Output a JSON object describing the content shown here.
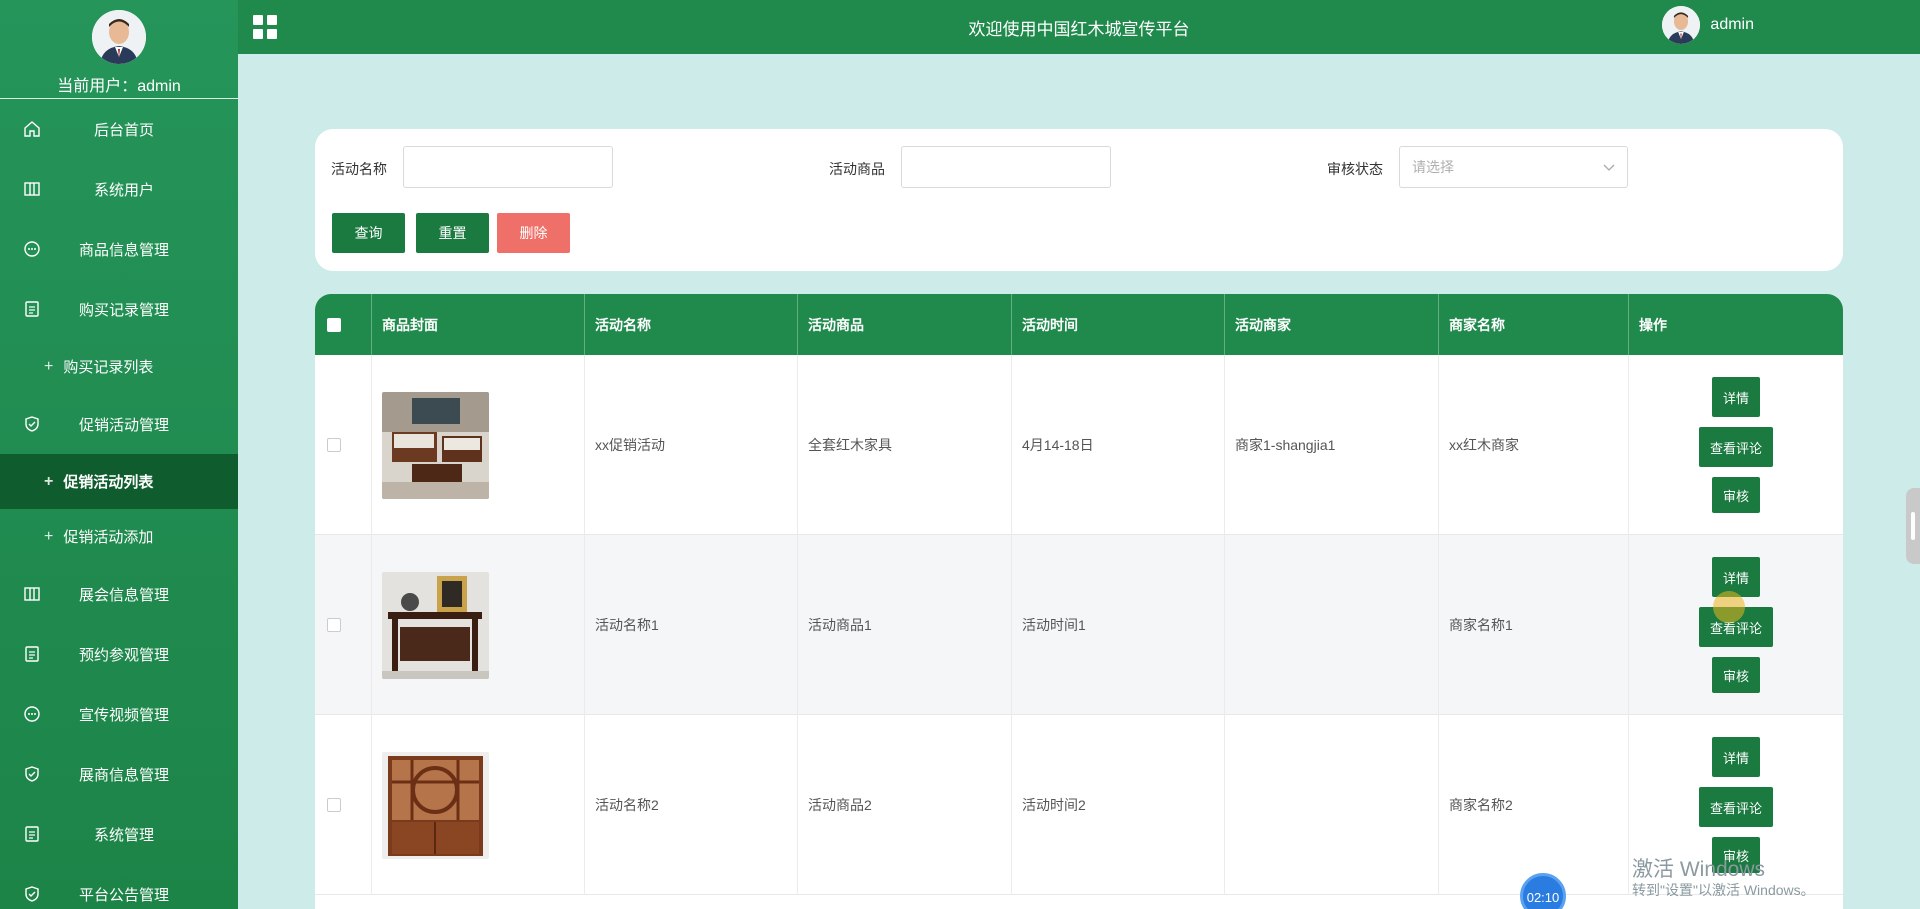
{
  "sidebar": {
    "user_label": "当前用户：admin",
    "items": [
      {
        "label": "后台首页",
        "icon": "home-icon"
      },
      {
        "label": "系统用户",
        "icon": "columns-icon"
      },
      {
        "label": "商品信息管理",
        "icon": "chat-icon"
      },
      {
        "label": "购买记录管理",
        "icon": "document-icon"
      },
      {
        "label": "购买记录列表",
        "sub": true
      },
      {
        "label": "促销活动管理",
        "icon": "shield-icon"
      },
      {
        "label": "促销活动列表",
        "sub": true,
        "active": true
      },
      {
        "label": "促销活动添加",
        "sub": true
      },
      {
        "label": "展会信息管理",
        "icon": "columns-icon"
      },
      {
        "label": "预约参观管理",
        "icon": "document-icon"
      },
      {
        "label": "宣传视频管理",
        "icon": "chat-icon"
      },
      {
        "label": "展商信息管理",
        "icon": "shield-icon"
      },
      {
        "label": "系统管理",
        "icon": "document-icon"
      },
      {
        "label": "平台公告管理",
        "icon": "shield-icon"
      }
    ]
  },
  "header": {
    "title": "欢迎使用中国红木城宣传平台",
    "username": "admin"
  },
  "search": {
    "activity_name_label": "活动名称",
    "activity_name_value": "",
    "activity_goods_label": "活动商品",
    "activity_goods_value": "",
    "status_label": "审核状态",
    "status_placeholder": "请选择",
    "query_label": "查询",
    "reset_label": "重置",
    "delete_label": "删除"
  },
  "table": {
    "headers": [
      "商品封面",
      "活动名称",
      "活动商品",
      "活动时间",
      "活动商家",
      "商家名称",
      "操作"
    ],
    "rows": [
      {
        "name": "xx促销活动",
        "goods": "全套红木家具",
        "time": "4月14-18日",
        "merchant": "商家1-shangjia1",
        "merchant_name": "xx红木商家"
      },
      {
        "name": "活动名称1",
        "goods": "活动商品1",
        "time": "活动时间1",
        "merchant": "",
        "merchant_name": "商家名称1"
      },
      {
        "name": "活动名称2",
        "goods": "活动商品2",
        "time": "活动时间2",
        "merchant": "",
        "merchant_name": "商家名称2"
      }
    ],
    "actions": {
      "detail": "详情",
      "comments": "查看评论",
      "review": "审核"
    }
  },
  "overlay": {
    "timer": "02:10",
    "watermark_title": "激活 Windows",
    "watermark_sub": "转到\"设置\"以激活 Windows。"
  },
  "colors": {
    "primary": "#1f8a4c",
    "active_menu": "#0f5c2e",
    "delete_button": "#ef7068",
    "background": "#cdebe9"
  }
}
